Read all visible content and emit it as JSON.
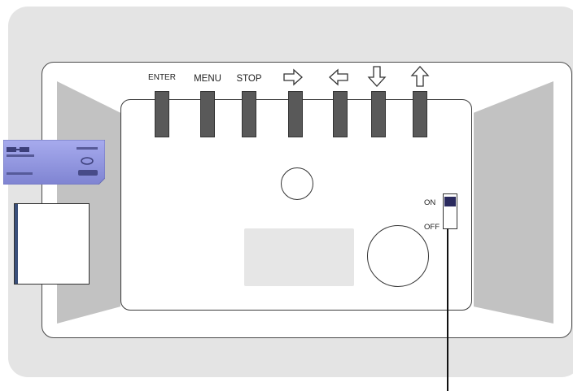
{
  "buttons": [
    {
      "label": "ENTER"
    },
    {
      "label": "MENU"
    },
    {
      "label": "STOP"
    },
    {
      "label": "",
      "icon": "arrow-right-icon"
    },
    {
      "label": "",
      "icon": "arrow-left-icon"
    },
    {
      "label": "",
      "icon": "arrow-down-icon"
    },
    {
      "label": "",
      "icon": "arrow-up-icon"
    }
  ],
  "power_switch": {
    "on_label": "ON",
    "off_label": "OFF",
    "state": "ON"
  },
  "colors": {
    "backdrop": "#e4e4e4",
    "side_panels": "#c2c2c2",
    "keys": "#595959",
    "switch_knob": "#2a2a5e",
    "memory_stick": "#8a8fd8",
    "sd_edge": "#3a4f7a"
  }
}
